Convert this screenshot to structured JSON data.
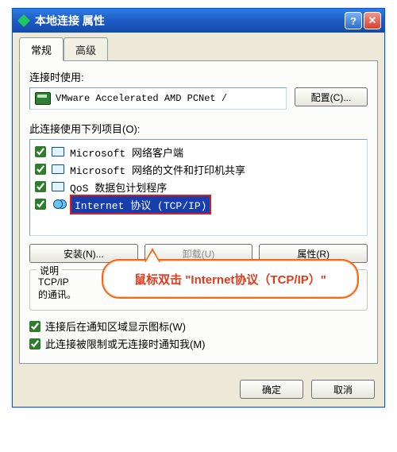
{
  "window": {
    "title": "本地连接 属性"
  },
  "tabs": {
    "general": "常规",
    "advanced": "高级"
  },
  "labels": {
    "connect_using": "连接时使用:",
    "uses_items": "此连接使用下列项目(O):",
    "description": "说明",
    "desc_text": "TCP/IP\n的通讯。"
  },
  "adapter": {
    "name": "VMware Accelerated AMD PCNet /"
  },
  "buttons": {
    "configure": "配置(C)...",
    "install": "安装(N)...",
    "uninstall": "卸载(U)",
    "properties": "属性(R)",
    "ok": "确定",
    "cancel": "取消"
  },
  "items": [
    {
      "checked": true,
      "icon": "monitor",
      "label": "Microsoft 网络客户端"
    },
    {
      "checked": true,
      "icon": "monitor",
      "label": "Microsoft 网络的文件和打印机共享"
    },
    {
      "checked": true,
      "icon": "monitor",
      "label": "QoS 数据包计划程序"
    },
    {
      "checked": true,
      "icon": "net",
      "label": "Internet 协议 (TCP/IP)",
      "selected": true
    }
  ],
  "options": {
    "show_icon": "连接后在通知区域显示图标(W)",
    "notify_limited": "此连接被限制或无连接时通知我(M)"
  },
  "callout": {
    "text": "鼠标双击 \"Internet协议（TCP/IP）\""
  }
}
